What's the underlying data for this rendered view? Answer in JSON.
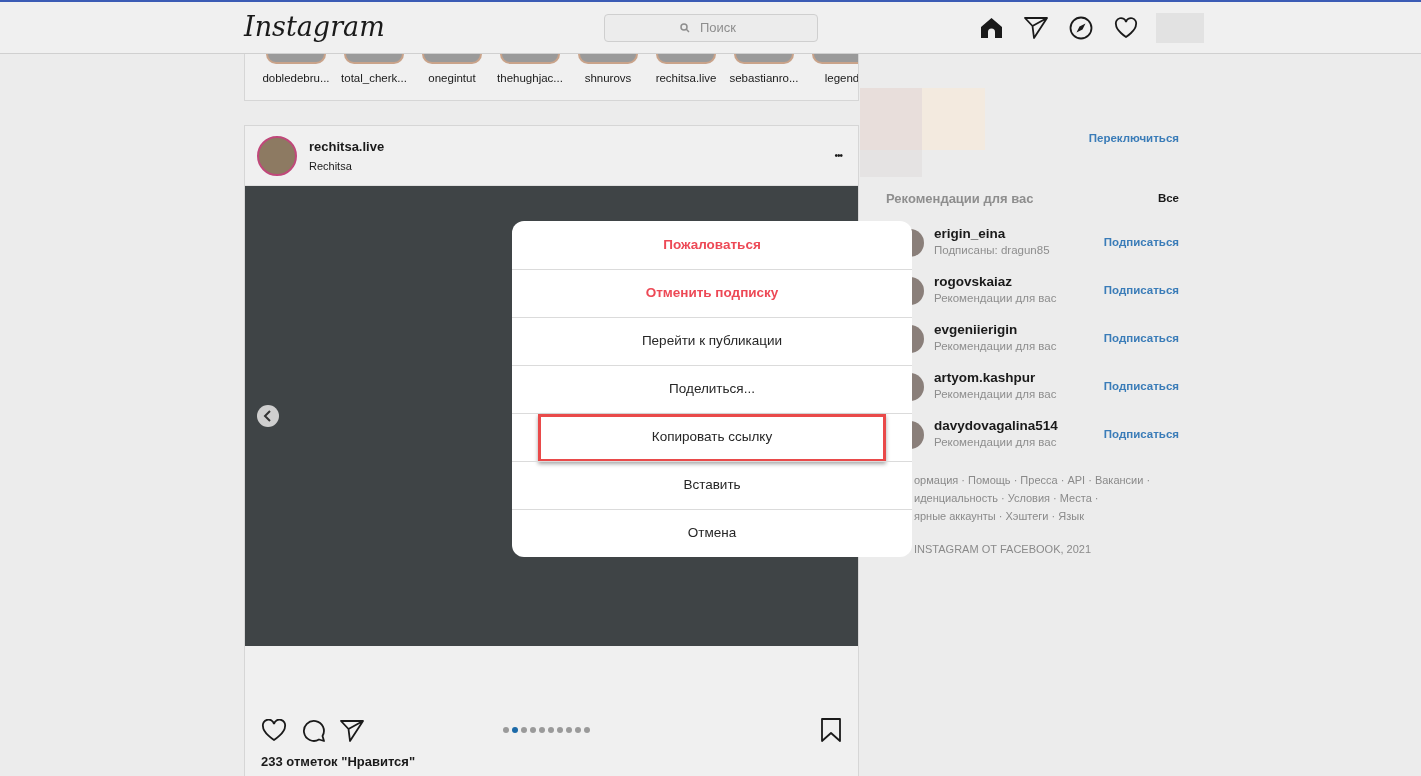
{
  "header": {
    "logo": "Instagram",
    "search": {
      "placeholder": "Поиск"
    }
  },
  "stories": [
    {
      "name": "dobledebru..."
    },
    {
      "name": "total_cherk..."
    },
    {
      "name": "onegintut"
    },
    {
      "name": "thehughjac..."
    },
    {
      "name": "shnurovs"
    },
    {
      "name": "rechitsa.live"
    },
    {
      "name": "sebastianro..."
    },
    {
      "name": "legend"
    }
  ],
  "post": {
    "author": "rechitsa.live",
    "location": "Rechitsa",
    "more": "•••",
    "carousel_dots": [
      {
        "selected": false
      },
      {
        "selected": true
      },
      {
        "selected": false
      },
      {
        "selected": false
      },
      {
        "selected": false
      },
      {
        "selected": false
      },
      {
        "selected": false
      },
      {
        "selected": false
      },
      {
        "selected": false
      },
      {
        "selected": false
      }
    ],
    "likes": "233 отметок \"Нравится\""
  },
  "sidebar": {
    "switch_link": "Переключиться",
    "suggestions_title": "Рекомендации для вас",
    "see_all": "Все",
    "suggestions": [
      {
        "username": "erigin_eina",
        "subtitle": "Подписаны: dragun85",
        "action": "Подписаться"
      },
      {
        "username": "rogovskaiaz",
        "subtitle": "Рекомендации для вас",
        "action": "Подписаться"
      },
      {
        "username": "evgeniierigin",
        "subtitle": "Рекомендации для вас",
        "action": "Подписаться"
      },
      {
        "username": "artyom.kashpur",
        "subtitle": "Рекомендации для вас",
        "action": "Подписаться"
      },
      {
        "username": "davydovagalina514",
        "subtitle": "Рекомендации для вас",
        "action": "Подписаться"
      }
    ],
    "footer_lines": [
      "ормация · Помощь · Пресса · API · Вакансии ·",
      "иденциальность · Условия · Места ·",
      "ярные аккаунты · Хэштеги · Язык"
    ],
    "copyright": "INSTAGRAM ОТ FACEBOOK, 2021"
  },
  "menu": {
    "items": [
      {
        "label": "Пожаловаться",
        "kind": "danger",
        "highlighted": false
      },
      {
        "label": "Отменить подписку",
        "kind": "danger",
        "highlighted": false
      },
      {
        "label": "Перейти к публикации",
        "kind": "normal",
        "highlighted": false
      },
      {
        "label": "Поделиться...",
        "kind": "normal",
        "highlighted": false
      },
      {
        "label": "Копировать ссылку",
        "kind": "normal",
        "highlighted": true
      },
      {
        "label": "Вставить",
        "kind": "normal",
        "highlighted": false
      },
      {
        "label": "Отмена",
        "kind": "normal",
        "highlighted": false
      }
    ]
  }
}
